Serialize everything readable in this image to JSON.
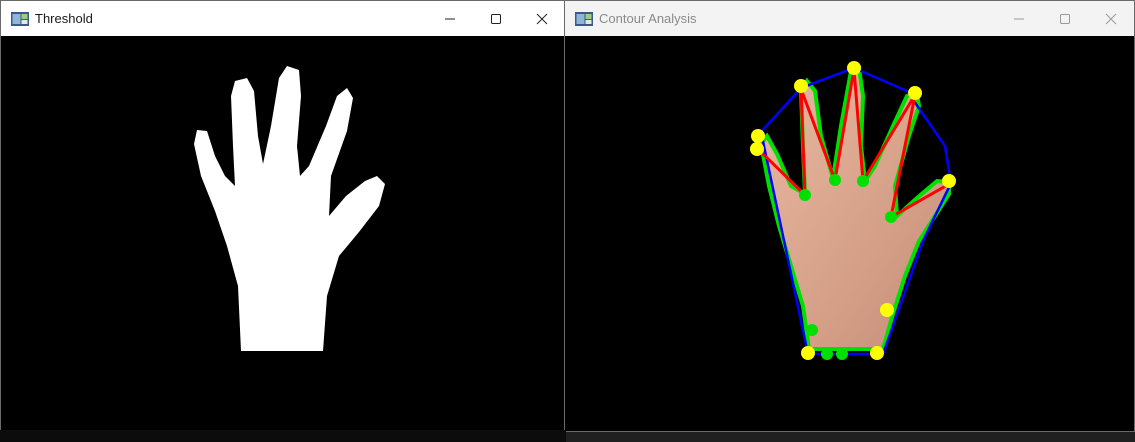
{
  "windows": {
    "threshold": {
      "title": "Threshold",
      "icon": "app-window-icon",
      "controls": [
        "minimize-icon",
        "maximize-icon",
        "close-icon"
      ],
      "active": true
    },
    "contour": {
      "title": "Contour Analysis",
      "icon": "app-window-icon",
      "controls": [
        "minimize-icon",
        "maximize-icon",
        "close-icon"
      ],
      "active": false
    }
  },
  "colors": {
    "hull": "#0000ff",
    "contour": "#00e000",
    "polygon": "#ff0000",
    "hull_points": "#ffff00",
    "defect_points": "#00e000",
    "mask": "#ffffff",
    "background": "#000000"
  }
}
